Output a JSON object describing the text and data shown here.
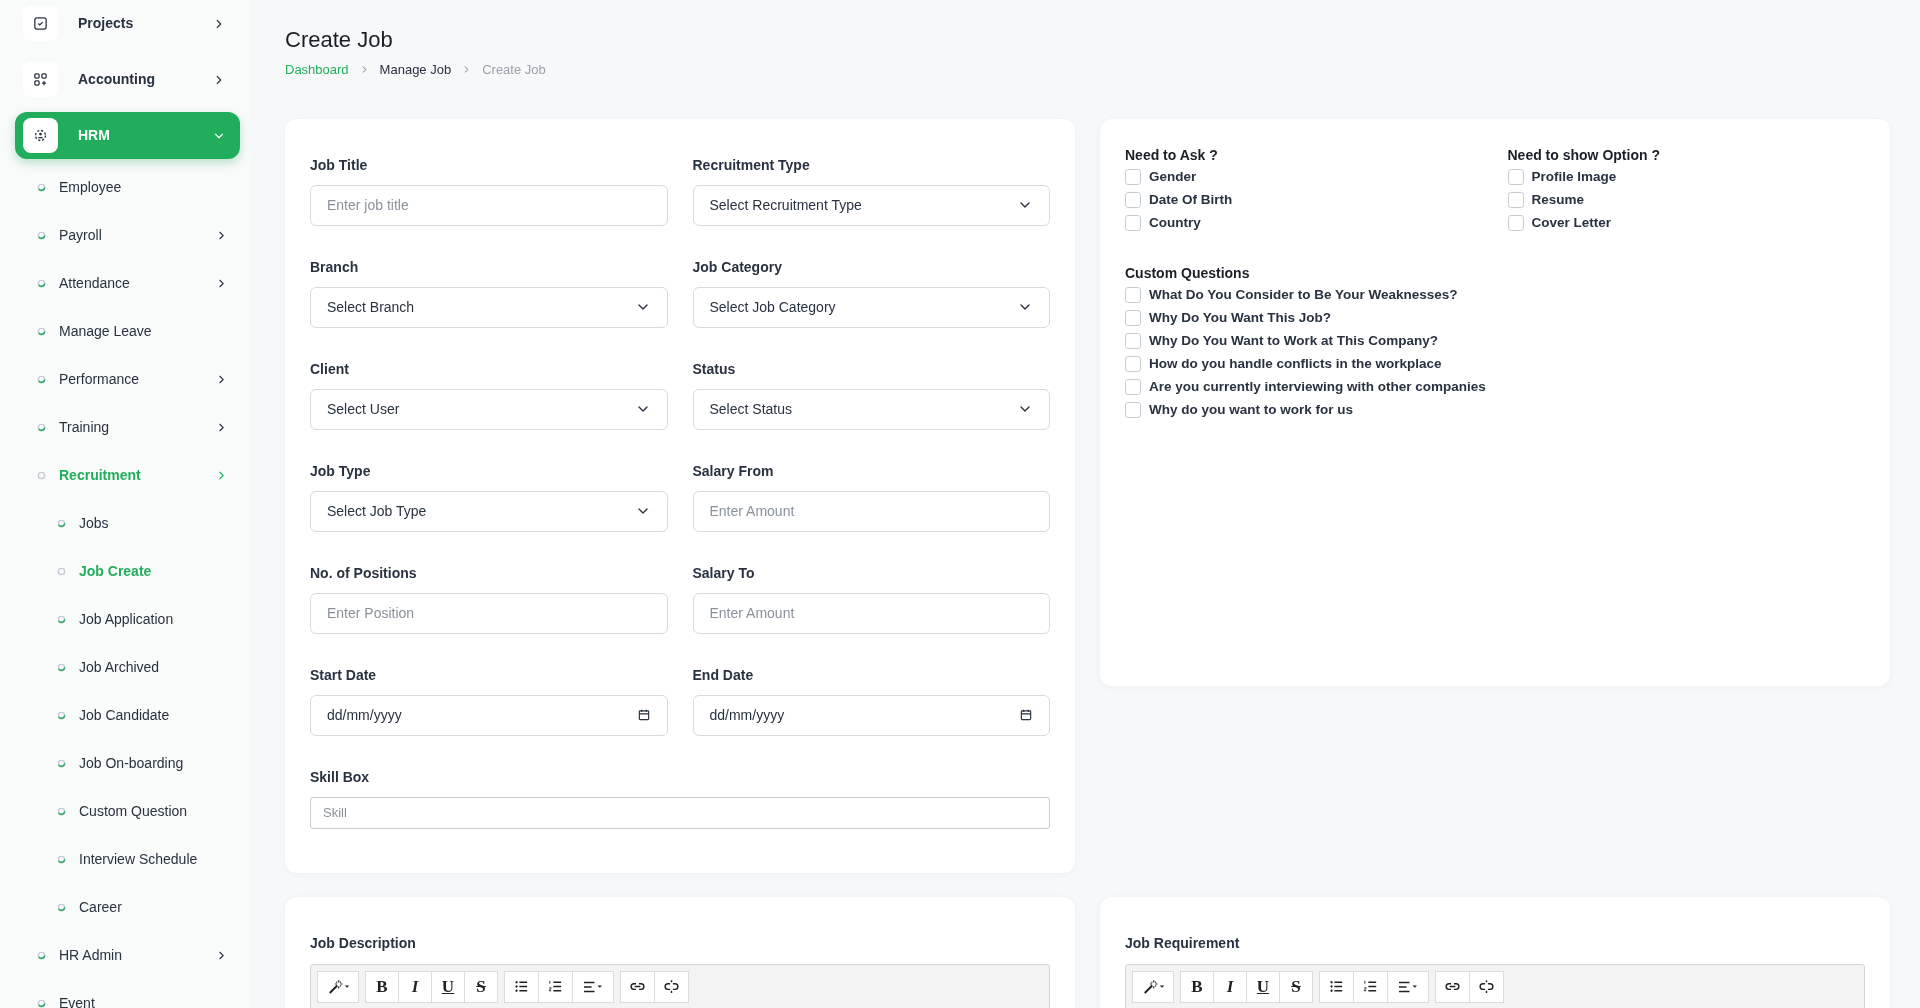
{
  "sidebar": {
    "modules": [
      {
        "label": "Projects",
        "selected": false,
        "expanded": false
      },
      {
        "label": "Accounting",
        "selected": false,
        "expanded": false
      },
      {
        "label": "HRM",
        "selected": true,
        "expanded": true,
        "children": [
          {
            "label": "Employee",
            "selected": false,
            "has_children": false
          },
          {
            "label": "Payroll",
            "selected": false,
            "has_children": true
          },
          {
            "label": "Attendance",
            "selected": false,
            "has_children": true
          },
          {
            "label": "Manage Leave",
            "selected": false,
            "has_children": false
          },
          {
            "label": "Performance",
            "selected": false,
            "has_children": true
          },
          {
            "label": "Training",
            "selected": false,
            "has_children": true
          },
          {
            "label": "Recruitment",
            "selected": true,
            "has_children": true,
            "children": [
              {
                "label": "Jobs",
                "selected": false
              },
              {
                "label": "Job Create",
                "selected": true
              },
              {
                "label": "Job Application",
                "selected": false
              },
              {
                "label": "Job Archived",
                "selected": false
              },
              {
                "label": "Job Candidate",
                "selected": false
              },
              {
                "label": "Job On-boarding",
                "selected": false
              },
              {
                "label": "Custom Question",
                "selected": false
              },
              {
                "label": "Interview Schedule",
                "selected": false
              },
              {
                "label": "Career",
                "selected": false
              }
            ]
          },
          {
            "label": "HR Admin",
            "selected": false,
            "has_children": true
          },
          {
            "label": "Event",
            "selected": false,
            "has_children": false
          }
        ]
      }
    ]
  },
  "page": {
    "title": "Create Job",
    "breadcrumb": [
      {
        "label": "Dashboard",
        "kind": "link"
      },
      {
        "label": "Manage Job",
        "kind": "parent"
      },
      {
        "label": "Create Job",
        "kind": "current"
      }
    ]
  },
  "form": {
    "fields": [
      {
        "label": "Job Title",
        "kind": "text",
        "placeholder": "Enter job title"
      },
      {
        "label": "Recruitment Type",
        "kind": "select",
        "value": "Select Recruitment Type"
      },
      {
        "label": "Branch",
        "kind": "select",
        "value": "Select Branch"
      },
      {
        "label": "Job Category",
        "kind": "select",
        "value": "Select Job Category"
      },
      {
        "label": "Client",
        "kind": "select",
        "value": "Select User"
      },
      {
        "label": "Status",
        "kind": "select",
        "value": "Select Status"
      },
      {
        "label": "Job Type",
        "kind": "select",
        "value": "Select Job Type"
      },
      {
        "label": "Salary From",
        "kind": "text",
        "placeholder": "Enter Amount"
      },
      {
        "label": "No. of Positions",
        "kind": "text",
        "placeholder": "Enter Position"
      },
      {
        "label": "Salary To",
        "kind": "text",
        "placeholder": "Enter Amount"
      },
      {
        "label": "Start Date",
        "kind": "date",
        "value": "dd/mm/yyyy"
      },
      {
        "label": "End Date",
        "kind": "date",
        "value": "dd/mm/yyyy"
      }
    ],
    "skill_box": {
      "label": "Skill Box",
      "placeholder": "Skill"
    }
  },
  "options": {
    "need_to_ask": {
      "title": "Need to Ask ?",
      "items": [
        {
          "label": "Gender",
          "checked": false
        },
        {
          "label": "Date Of Birth",
          "checked": false
        },
        {
          "label": "Country",
          "checked": false
        }
      ]
    },
    "need_to_show": {
      "title": "Need to show Option ?",
      "items": [
        {
          "label": "Profile Image",
          "checked": false
        },
        {
          "label": "Resume",
          "checked": false
        },
        {
          "label": "Cover Letter",
          "checked": false
        }
      ]
    },
    "custom_questions": {
      "title": "Custom Questions",
      "items": [
        {
          "label": "What Do You Consider to Be Your Weaknesses?",
          "checked": false
        },
        {
          "label": "Why Do You Want This Job?",
          "checked": false
        },
        {
          "label": "Why Do You Want to Work at This Company?",
          "checked": false
        },
        {
          "label": "How do you handle conflicts in the workplace",
          "checked": false
        },
        {
          "label": "Are you currently interviewing with other companies",
          "checked": false
        },
        {
          "label": "Why do you want to work for us",
          "checked": false
        }
      ]
    }
  },
  "editors": [
    {
      "label": "Job Description",
      "toolbar": [
        [
          {
            "kind": "magic"
          }
        ],
        [
          {
            "kind": "bold",
            "glyph": "B"
          },
          {
            "kind": "italic",
            "glyph": "I"
          },
          {
            "kind": "underline",
            "glyph": "U"
          },
          {
            "kind": "strike",
            "glyph": "S"
          }
        ],
        [
          {
            "kind": "ul"
          },
          {
            "kind": "ol"
          },
          {
            "kind": "align"
          }
        ],
        [
          {
            "kind": "link"
          },
          {
            "kind": "unlink"
          }
        ]
      ]
    },
    {
      "label": "Job Requirement",
      "toolbar": [
        [
          {
            "kind": "magic"
          }
        ],
        [
          {
            "kind": "bold",
            "glyph": "B"
          },
          {
            "kind": "italic",
            "glyph": "I"
          },
          {
            "kind": "underline",
            "glyph": "U"
          },
          {
            "kind": "strike",
            "glyph": "S"
          }
        ],
        [
          {
            "kind": "ul"
          },
          {
            "kind": "ol"
          },
          {
            "kind": "align"
          }
        ],
        [
          {
            "kind": "link"
          },
          {
            "kind": "unlink"
          }
        ]
      ]
    }
  ]
}
